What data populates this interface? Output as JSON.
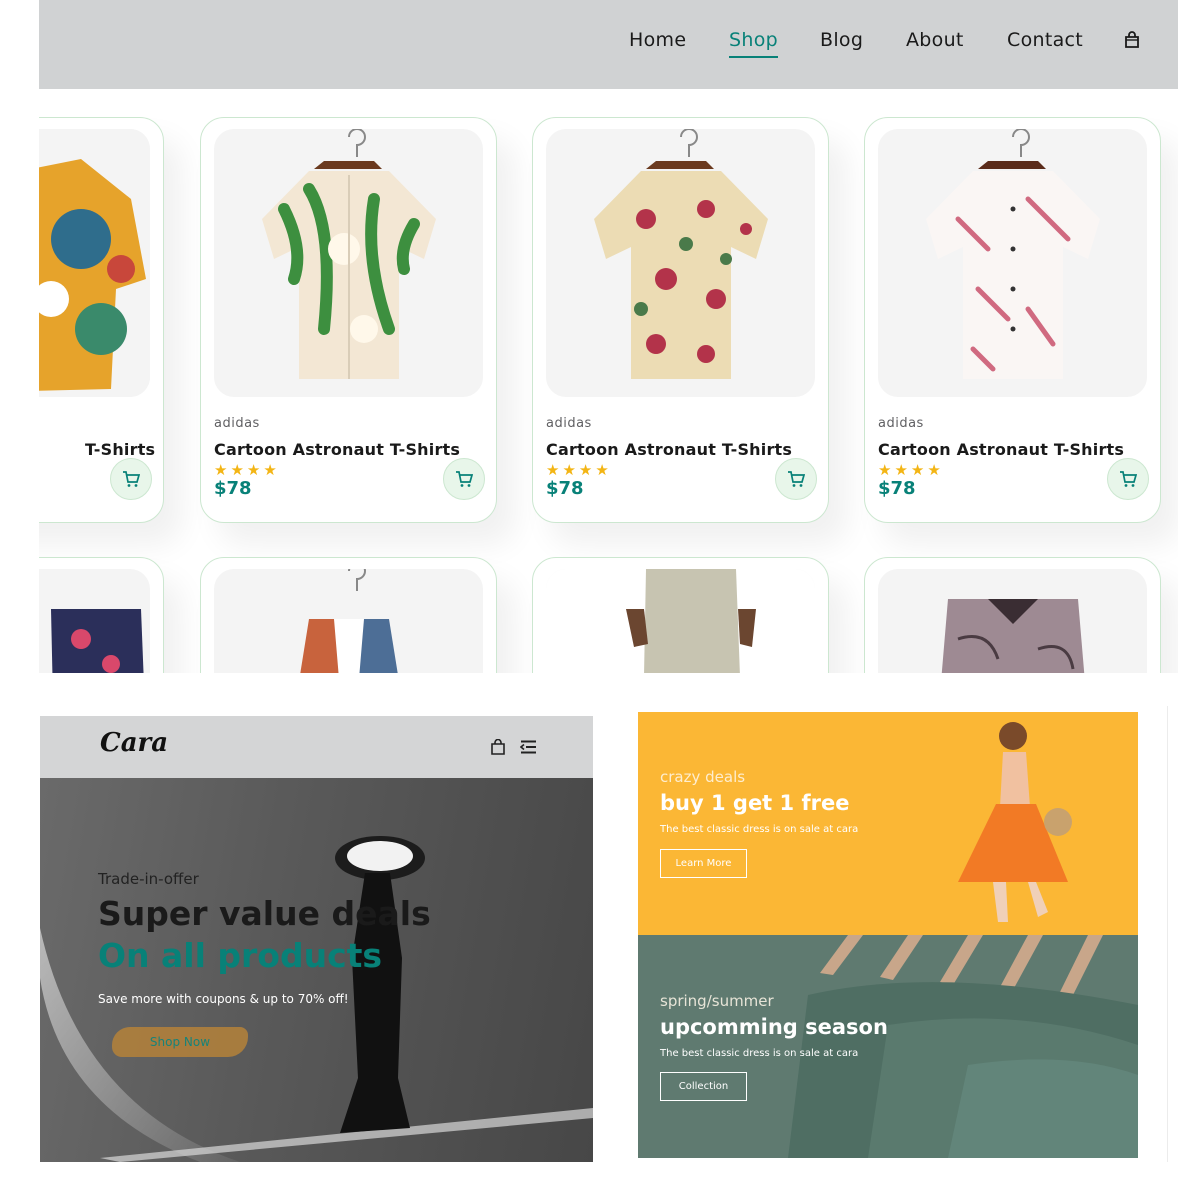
{
  "nav": {
    "items": [
      "Home",
      "Shop",
      "Blog",
      "About",
      "Contact"
    ],
    "active": "Shop",
    "bag_icon": "shopping-bag-icon"
  },
  "products": [
    {
      "brand": "adidas",
      "name": "Cartoon Astronaut T-Shirts",
      "rating": 4,
      "stars": "★★★★",
      "price": "$78"
    },
    {
      "brand": "adidas",
      "name": "Cartoon Astronaut T-Shirts",
      "rating": 4,
      "stars": "★★★★",
      "price": "$78"
    },
    {
      "brand": "adidas",
      "name": "Cartoon Astronaut T-Shirts",
      "rating": 4,
      "stars": "★★★★",
      "price": "$78"
    },
    {
      "brand": "adidas",
      "name": "Cartoon Astronaut T-Shirts",
      "rating": 4,
      "stars": "★★★★",
      "price": "$78"
    }
  ],
  "partial_card": {
    "name": "T-Shirts"
  },
  "hero": {
    "logo": "Cara",
    "subtitle": "Trade-in-offer",
    "title_line1": "Super value deals",
    "title_line2": "On all products",
    "description": "Save more with coupons & up to 70% off!",
    "button": "Shop Now"
  },
  "banners": [
    {
      "kicker": "crazy deals",
      "title": "buy 1 get 1 free",
      "description": "The best classic dress is on sale at cara",
      "button": "Learn More"
    },
    {
      "kicker": "spring/summer",
      "title": "upcomming season",
      "description": "The best classic dress is on sale at cara",
      "button": "Collection"
    }
  ],
  "colors": {
    "accent": "#088178",
    "navbar_bg": "#d0d2d3",
    "star": "#f3b515",
    "banner_yellow": "#fbb735",
    "banner_green": "#5f7a70"
  }
}
